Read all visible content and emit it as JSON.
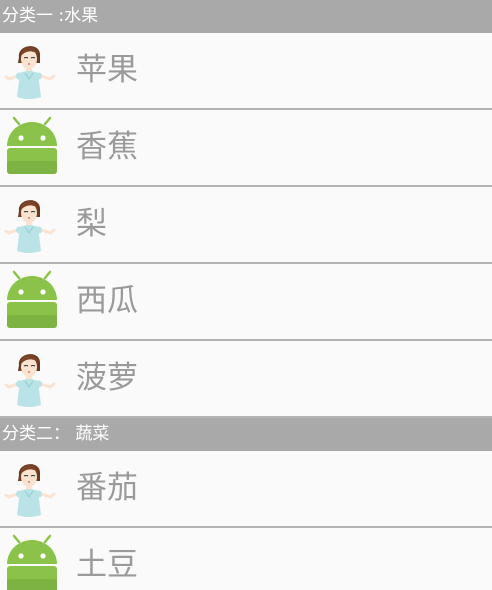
{
  "sections": [
    {
      "title": "分类一 :水果",
      "items": [
        {
          "label": "苹果",
          "icon": "girl-avatar-icon"
        },
        {
          "label": "香蕉",
          "icon": "android-icon"
        },
        {
          "label": "梨",
          "icon": "girl-avatar-icon"
        },
        {
          "label": "西瓜",
          "icon": "android-icon"
        },
        {
          "label": "菠萝",
          "icon": "girl-avatar-icon"
        }
      ]
    },
    {
      "title": "分类二： 蔬菜",
      "items": [
        {
          "label": "番茄",
          "icon": "girl-avatar-icon"
        },
        {
          "label": "土豆",
          "icon": "android-icon"
        }
      ]
    }
  ],
  "colors": {
    "header_bg": "#a9a9a9",
    "header_text": "#ffffff",
    "item_text": "#9a9a9a",
    "divider": "#b3b3b3",
    "android_green": "#8bc34a"
  }
}
